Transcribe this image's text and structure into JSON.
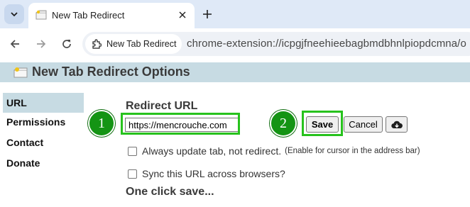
{
  "browser": {
    "tab_title": "New Tab Redirect",
    "address_chip_label": "New Tab Redirect",
    "url": "chrome-extension://icpgjfneehieebagbmdbhnlpiopdcmna/o"
  },
  "page": {
    "title": "New Tab Redirect Options"
  },
  "sidebar": {
    "items": [
      {
        "label": "URL",
        "active": true
      },
      {
        "label": "Permissions",
        "active": false
      },
      {
        "label": "Contact",
        "active": false
      },
      {
        "label": "Donate",
        "active": false
      }
    ]
  },
  "main": {
    "section_title": "Redirect URL",
    "url_input_value": "https://mencrouche.com",
    "save_label": "Save",
    "cancel_label": "Cancel",
    "options": [
      {
        "label": "Always update tab, not redirect.",
        "note": "(Enable for cursor in the address bar)",
        "checked": false
      },
      {
        "label": "Sync this URL across browsers?",
        "checked": false
      }
    ],
    "one_click_title": "One click save..."
  },
  "annotations": {
    "badge_1": "1",
    "badge_2": "2",
    "highlight_color": "#27c21d",
    "badge_color": "#149414"
  },
  "icons": [
    "chevron-down-icon",
    "tab-favicon-icon",
    "close-icon",
    "plus-icon",
    "back-arrow-icon",
    "forward-arrow-icon",
    "reload-icon",
    "extension-icon",
    "header-logo-icon",
    "cloud-download-icon"
  ],
  "colors": {
    "tabstrip_bg": "#dfe9f7",
    "header_bg": "#c7dbe3"
  }
}
